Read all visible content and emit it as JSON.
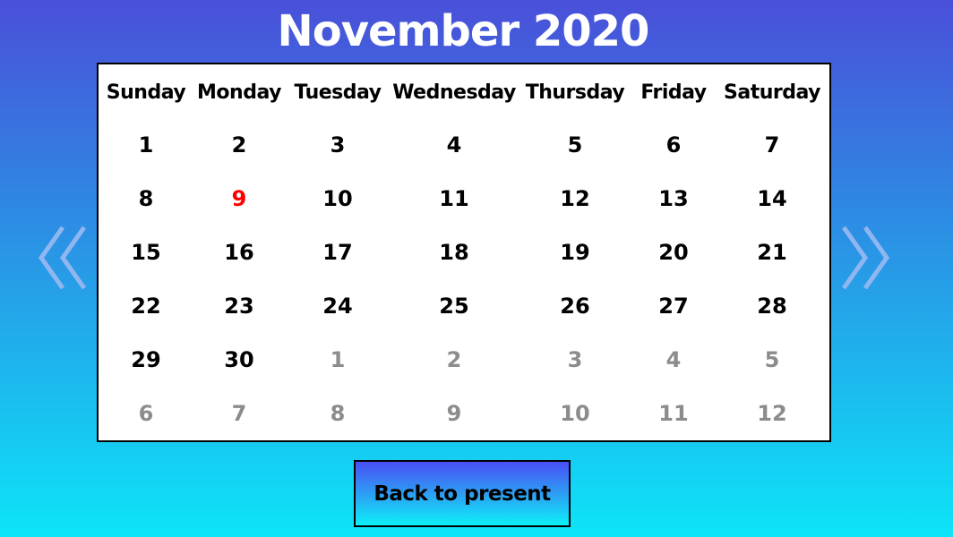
{
  "header": {
    "month_year": "November 2020"
  },
  "weekdays": [
    "Sunday",
    "Monday",
    "Tuesday",
    "Wednesday",
    "Thursday",
    "Friday",
    "Saturday"
  ],
  "weeks": [
    [
      "1",
      "2",
      "3",
      "4",
      "5",
      "6",
      "7"
    ],
    [
      "8",
      "9",
      "10",
      "11",
      "12",
      "13",
      "14"
    ],
    [
      "15",
      "16",
      "17",
      "18",
      "19",
      "20",
      "21"
    ],
    [
      "22",
      "23",
      "24",
      "25",
      "26",
      "27",
      "28"
    ],
    [
      "29",
      "30",
      "1",
      "2",
      "3",
      "4",
      "5"
    ],
    [
      "6",
      "7",
      "8",
      "9",
      "10",
      "11",
      "12"
    ]
  ],
  "highlighted_day": "9",
  "colors": {
    "current_month_day": "#000000",
    "other_month_day": "#8c8c8c",
    "highlighted_day": "#ff0000",
    "nav_arrow": "#8fb6f0"
  },
  "nav": {
    "prev_icon": "double-chevron-left-icon",
    "next_icon": "double-chevron-right-icon"
  },
  "footer": {
    "back_button_label": "Back to present"
  }
}
